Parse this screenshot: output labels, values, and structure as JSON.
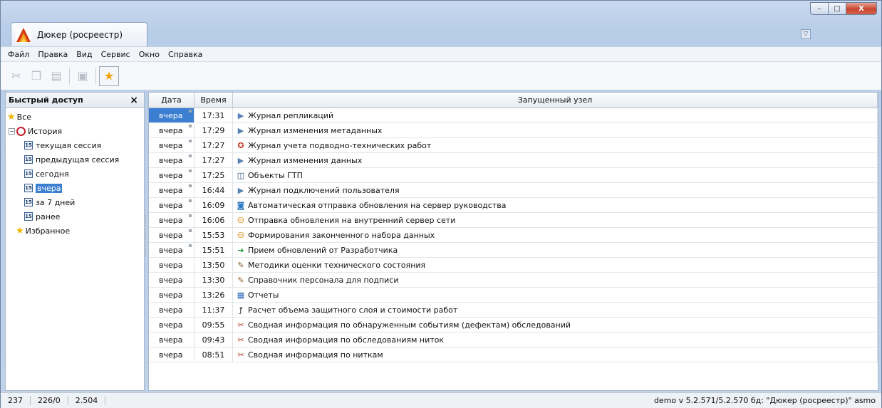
{
  "window": {
    "tab_title": "Дюкер (росреестр)",
    "controls": {
      "minimize": "–",
      "maximize": "□",
      "close": "X"
    },
    "dropdown_icon": "▽"
  },
  "menu": [
    "Файл",
    "Правка",
    "Вид",
    "Сервис",
    "Окно",
    "Справка"
  ],
  "toolbar": {
    "buttons": [
      "cut-icon",
      "copy-icon",
      "paste-icon",
      "properties-icon",
      "favorite-star-icon"
    ]
  },
  "quick_access": {
    "title": "Быстрый доступ",
    "close": "×",
    "tree": {
      "all": "Все",
      "history": "История",
      "history_items": [
        "текущая сессия",
        "предыдущая сессия",
        "сегодня",
        "вчера",
        "за 7 дней",
        "ранее"
      ],
      "selected": "вчера",
      "favorites": "Избранное"
    }
  },
  "grid": {
    "columns": [
      "Дата",
      "Время",
      "Запущенный узел"
    ],
    "rows": [
      {
        "date": "вчера",
        "time": "17:31",
        "icon": "triangle-play-icon",
        "node": "Журнал репликаций",
        "marked": true,
        "selected": true
      },
      {
        "date": "вчера",
        "time": "17:29",
        "icon": "triangle-play-icon",
        "node": "Журнал изменения метаданных",
        "marked": true
      },
      {
        "date": "вчера",
        "time": "17:27",
        "icon": "badge-icon",
        "node": "Журнал учета подводно-технических работ",
        "marked": true
      },
      {
        "date": "вчера",
        "time": "17:27",
        "icon": "triangle-play-icon",
        "node": "Журнал изменения данных",
        "marked": true
      },
      {
        "date": "вчера",
        "time": "17:25",
        "icon": "object-icon",
        "node": "Объекты ГТП",
        "marked": true
      },
      {
        "date": "вчера",
        "time": "16:44",
        "icon": "triangle-play-icon",
        "node": "Журнал подключений пользователя",
        "marked": true
      },
      {
        "date": "вчера",
        "time": "16:09",
        "icon": "auto-send-icon",
        "node": "Автоматическая отправка обновления на сервер руководства",
        "marked": true
      },
      {
        "date": "вчера",
        "time": "16:06",
        "icon": "db-send-icon",
        "node": "Отправка обновления на внутренний сервер сети",
        "marked": true
      },
      {
        "date": "вчера",
        "time": "15:53",
        "icon": "db-send-icon",
        "node": "Формирования законченного набора данных",
        "marked": true
      },
      {
        "date": "вчера",
        "time": "15:51",
        "icon": "receive-icon",
        "node": "Прием обновлений от Разработчика",
        "marked": true
      },
      {
        "date": "вчера",
        "time": "13:50",
        "icon": "book-icon",
        "node": "Методики оценки технического состояния",
        "marked": false
      },
      {
        "date": "вчера",
        "time": "13:30",
        "icon": "book-icon",
        "node": "Справочник персонала для подписи",
        "marked": false
      },
      {
        "date": "вчера",
        "time": "13:26",
        "icon": "report-icon",
        "node": "Отчеты",
        "marked": false
      },
      {
        "date": "вчера",
        "time": "11:37",
        "icon": "function-icon",
        "node": "Расчет объема защитного слоя  и стоимости работ",
        "marked": false
      },
      {
        "date": "вчера",
        "time": "09:55",
        "icon": "summary-icon",
        "node": "Сводная информация по обнаруженным событиям (дефектам) обследований",
        "marked": false
      },
      {
        "date": "вчера",
        "time": "09:43",
        "icon": "summary-icon",
        "node": "Сводная информация по обследованиям ниток",
        "marked": false
      },
      {
        "date": "вчера",
        "time": "08:51",
        "icon": "summary-icon",
        "node": "Сводная информация по ниткам",
        "marked": false
      }
    ]
  },
  "status": {
    "cells": [
      "237",
      "226/0",
      "2.504"
    ],
    "right": "demo  v 5.2.571/5.2.570  бд: \"Дюкер (росреестр)\" asmo"
  }
}
